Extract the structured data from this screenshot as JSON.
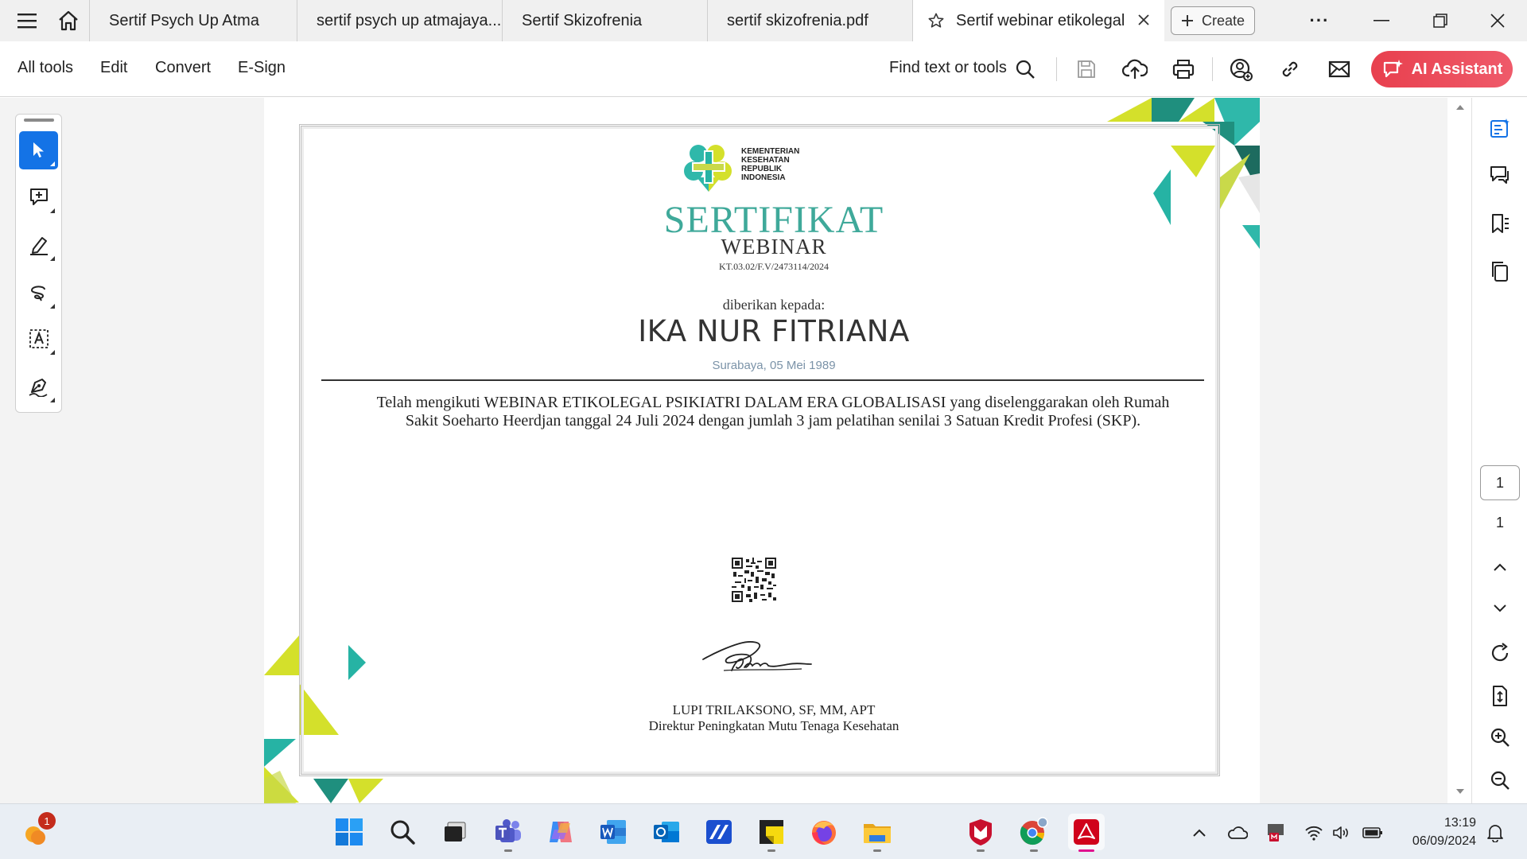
{
  "tabs": [
    {
      "label": "Sertif Psych Up Atma"
    },
    {
      "label": "sertif psych up atmajaya...."
    },
    {
      "label": "Sertif Skizofrenia"
    },
    {
      "label": "sertif skizofrenia.pdf"
    },
    {
      "label": "Sertif webinar etikolegal",
      "active": true
    }
  ],
  "tabbar": {
    "create_label": "Create",
    "more_label": "···"
  },
  "menu": {
    "all_tools": "All tools",
    "edit": "Edit",
    "convert": "Convert",
    "esign": "E-Sign"
  },
  "toolbar": {
    "find_label": "Find text or tools",
    "ai_assistant": "AI Assistant"
  },
  "page_nav": {
    "current": "1",
    "total": "1"
  },
  "certificate": {
    "ministry_line1": "KEMENTERIAN",
    "ministry_line2": "KESEHATAN",
    "ministry_line3": "REPUBLIK",
    "ministry_line4": "INDONESIA",
    "title": "SERTIFIKAT",
    "subtitle": "WEBINAR",
    "number": "KT.03.02/F.V/2473114/2024",
    "given_to": "diberikan kepada:",
    "recipient": "IKA NUR FITRIANA",
    "birth_place_date": "Surabaya, 05 Mei 1989",
    "body": "Telah mengikuti WEBINAR ETIKOLEGAL PSIKIATRI DALAM ERA GLOBALISASI yang diselenggarakan oleh Rumah Sakit Soeharto Heerdjan tanggal 24 Juli 2024 dengan jumlah 3 jam pelatihan senilai 3 Satuan Kredit Profesi (SKP).",
    "signer_name": "LUPI TRILAKSONO, SF, MM, APT",
    "signer_role": "Direktur Peningkatan Mutu Tenaga Kesehatan"
  },
  "taskbar": {
    "notification_count": "1",
    "time": "13:19",
    "date": "06/09/2024"
  },
  "colors": {
    "accent_teal": "#3fa99a",
    "lime": "#d4e02b",
    "ai_button": "#e8404e",
    "acrobat_red": "#d0021b",
    "active_tool": "#1473e6"
  }
}
